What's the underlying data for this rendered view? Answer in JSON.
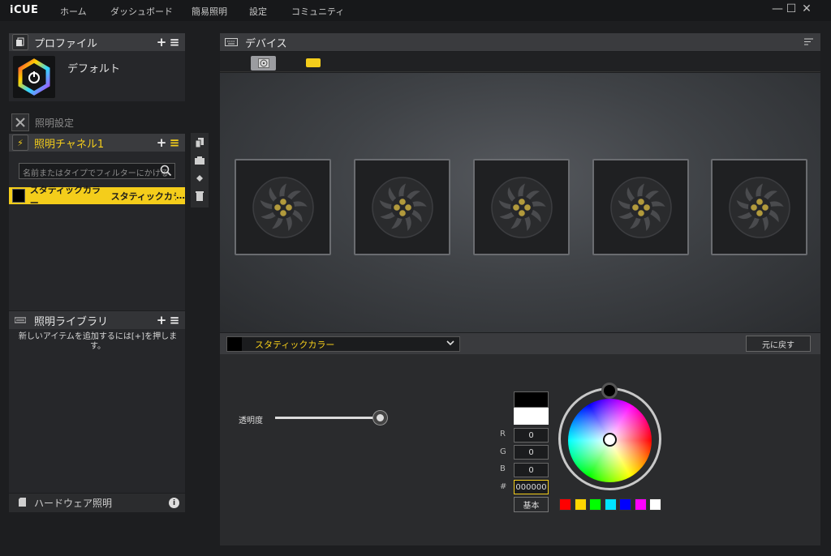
{
  "app": {
    "brand": "iCUE"
  },
  "nav": [
    "ホーム",
    "ダッシュボード",
    "簡易照明",
    "設定",
    "コミュニティ"
  ],
  "window_controls": {
    "minimize": "—",
    "maximize": "☐",
    "close": "✕"
  },
  "profiles": {
    "title": "プロファイル",
    "add": "+",
    "menu": "≡",
    "default_name": "デフォルト"
  },
  "lighting_setup": {
    "title": "照明設定"
  },
  "channel": {
    "title": "照明チャネル1",
    "add": "+",
    "menu": "≡",
    "filter_placeholder": "名前またはタイプでフィルターにかける",
    "layer": {
      "type": "スタティックカラー",
      "name": "スタティックカラー"
    }
  },
  "library": {
    "title": "照明ライブラリ",
    "add": "+",
    "menu": "≡",
    "message": "新しいアイテムを追加するには[+]を押します。"
  },
  "hardware": {
    "label": "ハードウェア照明",
    "info": "i"
  },
  "devices": {
    "title": "デバイス",
    "fan_count": 5
  },
  "effect": {
    "selected": "スタティックカラー",
    "revert": "元に戻す",
    "opacity_label": "透明度",
    "opacity_value": 1.0,
    "r_label": "R",
    "g_label": "G",
    "b_label": "B",
    "hex_label": "#",
    "r": "0",
    "g": "0",
    "b": "0",
    "hex": "000000",
    "basic": "基本",
    "presets": [
      "#ff0000",
      "#ffd700",
      "#00ff00",
      "#00e5ff",
      "#0000ff",
      "#ff00ff",
      "#ffffff"
    ]
  },
  "colors": {
    "accent": "#f4cd1b"
  }
}
